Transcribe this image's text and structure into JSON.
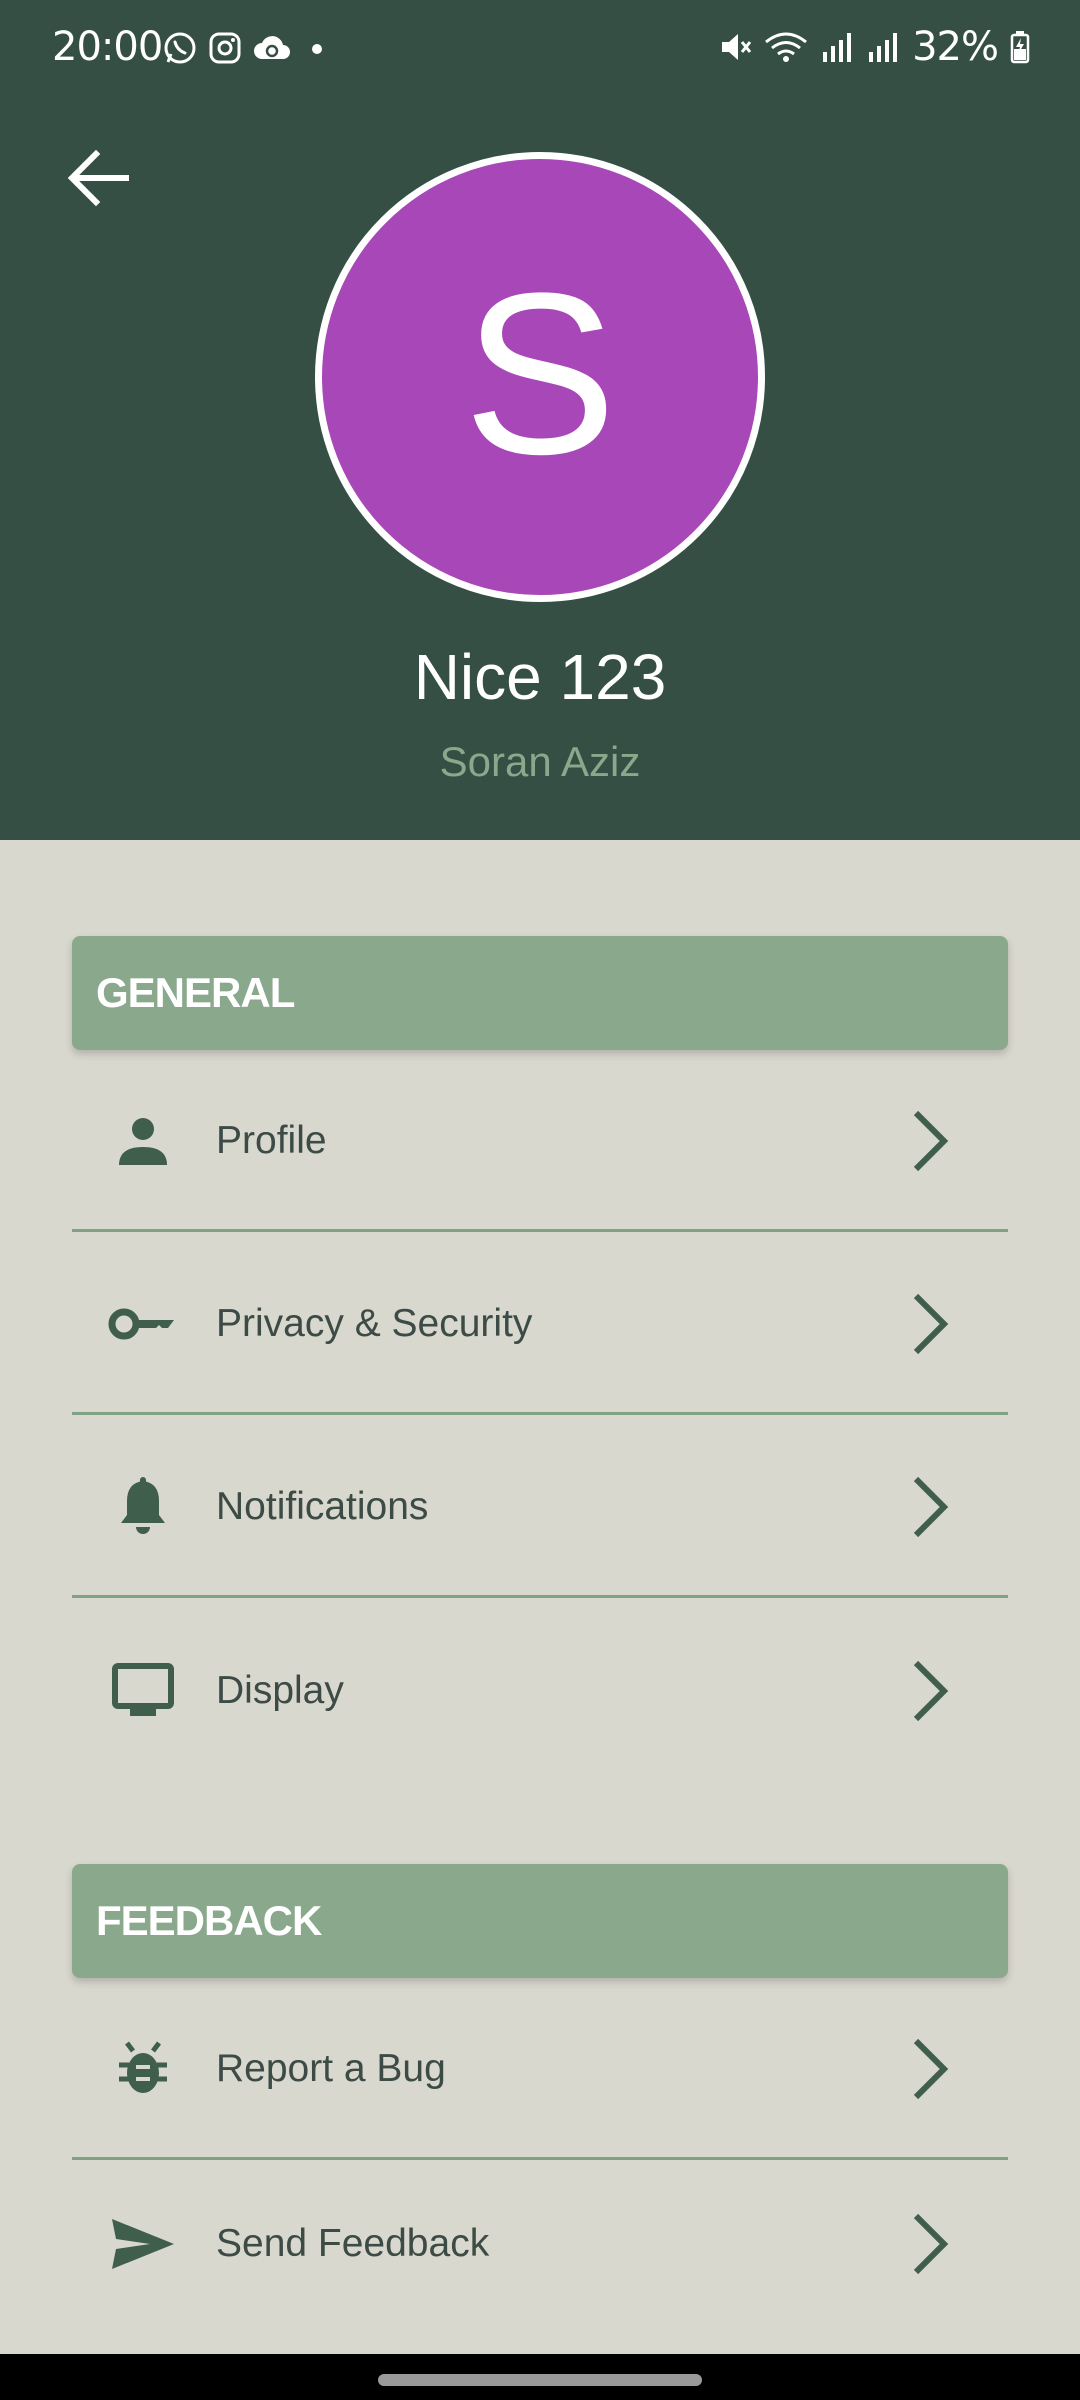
{
  "status_bar": {
    "time": "20:00",
    "battery": "32%",
    "left_icons": [
      "whatsapp-icon",
      "instagram-icon",
      "cloud-sync-icon",
      "dot-icon"
    ],
    "right_icons": [
      "mute-icon",
      "wifi-icon",
      "signal-icon",
      "signal-icon",
      "battery-charging-icon"
    ]
  },
  "header": {
    "background": "#354f45",
    "back_icon": "arrow-left-icon",
    "avatar_letter": "S",
    "avatar_color": "#a847b8",
    "name": "Nice 123",
    "subtitle": "Soran Aziz"
  },
  "sections": {
    "general": {
      "title": "GENERAL",
      "items": [
        {
          "label": "Profile",
          "icon": "person-icon"
        },
        {
          "label": "Privacy & Security",
          "icon": "key-icon"
        },
        {
          "label": "Notifications",
          "icon": "bell-icon"
        },
        {
          "label": "Display",
          "icon": "monitor-icon"
        }
      ]
    },
    "feedback": {
      "title": "FEEDBACK",
      "items": [
        {
          "label": "Report a Bug",
          "icon": "bug-icon"
        },
        {
          "label": "Send Feedback",
          "icon": "send-icon"
        }
      ]
    }
  },
  "colors": {
    "accent": "#8aa88c",
    "icon": "#3f5e4c",
    "text": "#3d4b46",
    "page_background": "#d9d8ce"
  }
}
